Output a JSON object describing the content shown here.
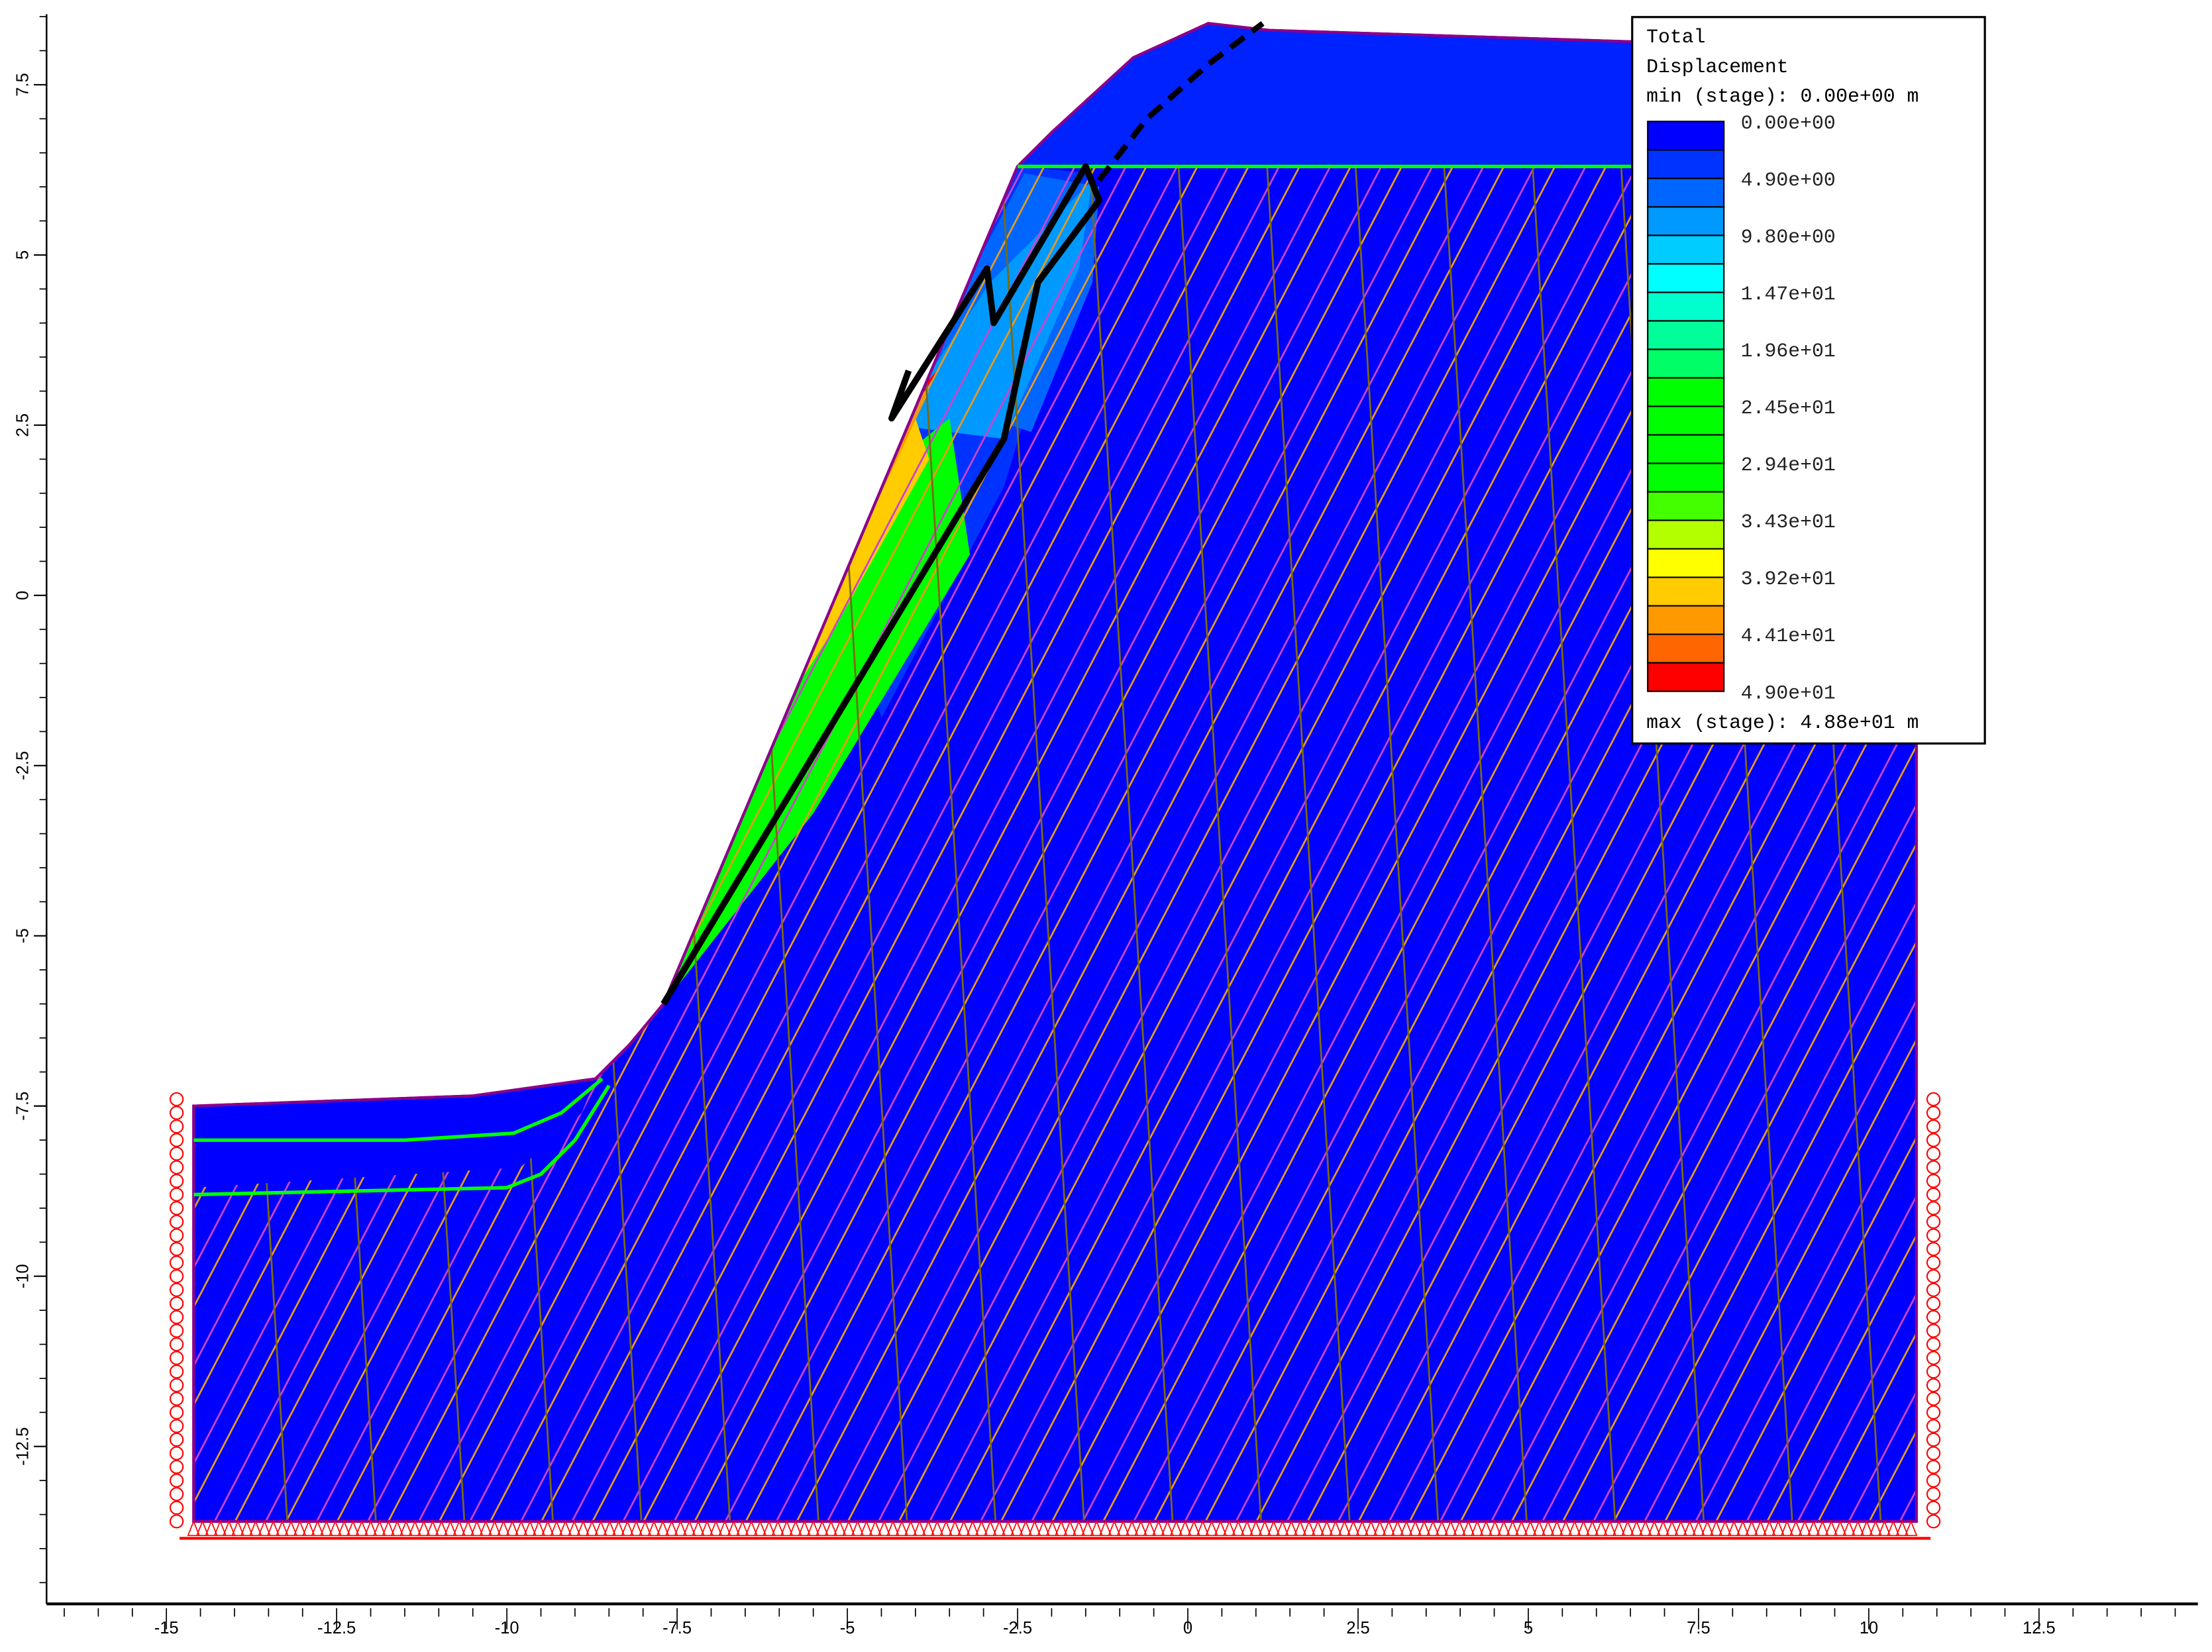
{
  "chart_data": {
    "type": "heatmap",
    "title": "Total Displacement",
    "xlim": [
      -16.5,
      14.5
    ],
    "ylim": [
      -14.8,
      8.5
    ],
    "x_ticks": [
      -15,
      -12.5,
      -10,
      -7.5,
      -5,
      -2.5,
      0,
      2.5,
      5,
      7.5,
      10,
      12.5
    ],
    "x_tick_labels": [
      "-15",
      "-12.5",
      "-10",
      "-7.5",
      "-5",
      "-2.5",
      "0",
      "2.5",
      "5",
      "7.5",
      "10",
      "12.5"
    ],
    "y_ticks": [
      7.5,
      5,
      2.5,
      0,
      -2.5,
      -5,
      -7.5,
      -10,
      -12.5
    ],
    "y_tick_labels": [
      "7.5",
      "5",
      "2.5",
      "0",
      "-2.5",
      "-5",
      "-7.5",
      "-10",
      "-12.5"
    ],
    "grid": false,
    "legend": {
      "placement": "top-right",
      "title_line1": "Total",
      "title_line2": "Displacement",
      "min_text": "min (stage): 0.00e+00 m",
      "max_text": "max (stage): 4.88e+01 m",
      "labels": [
        "0.00e+00",
        "4.90e+00",
        "9.80e+00",
        "1.47e+01",
        "1.96e+01",
        "2.45e+01",
        "2.94e+01",
        "3.43e+01",
        "3.92e+01",
        "4.41e+01",
        "4.90e+01"
      ],
      "colors": [
        "#0000ff",
        "#0033ff",
        "#0066ff",
        "#0099ff",
        "#00ccff",
        "#00ffff",
        "#00ffcc",
        "#00ff99",
        "#00ff66",
        "#00ff00",
        "#00ff00",
        "#00ff00",
        "#00ff00",
        "#44ff00",
        "#b3ff00",
        "#ffff00",
        "#ffcc00",
        "#ff9900",
        "#ff6600",
        "#ff0000"
      ]
    },
    "model": {
      "ground_profile": [
        [
          -14.6,
          -7.5
        ],
        [
          -10.5,
          -7.35
        ],
        [
          -8.7,
          -7.1
        ],
        [
          -8.2,
          -6.6
        ],
        [
          -7.7,
          -6.0
        ],
        [
          -2.5,
          6.3
        ],
        [
          -2.0,
          6.8
        ],
        [
          -0.8,
          7.9
        ],
        [
          0.3,
          8.4
        ],
        [
          1.2,
          8.3
        ],
        [
          10.7,
          8.0
        ],
        [
          10.7,
          -13.6
        ],
        [
          -14.6,
          -13.6
        ]
      ],
      "failure_surface": [
        [
          -7.7,
          -6.0
        ],
        [
          -2.7,
          2.3
        ],
        [
          -2.2,
          4.6
        ],
        [
          -1.3,
          5.8
        ],
        [
          -1.5,
          6.3
        ],
        [
          -2.85,
          4.0
        ],
        [
          -2.95,
          4.8
        ],
        [
          -4.35,
          2.6
        ],
        [
          -4.1,
          3.3
        ]
      ],
      "dashed_line": [
        [
          -1.3,
          6.1
        ],
        [
          -0.6,
          7.0
        ],
        [
          0.3,
          7.8
        ],
        [
          1.1,
          8.4
        ]
      ],
      "max_displacement_m": 48.8,
      "min_displacement_m": 0.0
    }
  }
}
